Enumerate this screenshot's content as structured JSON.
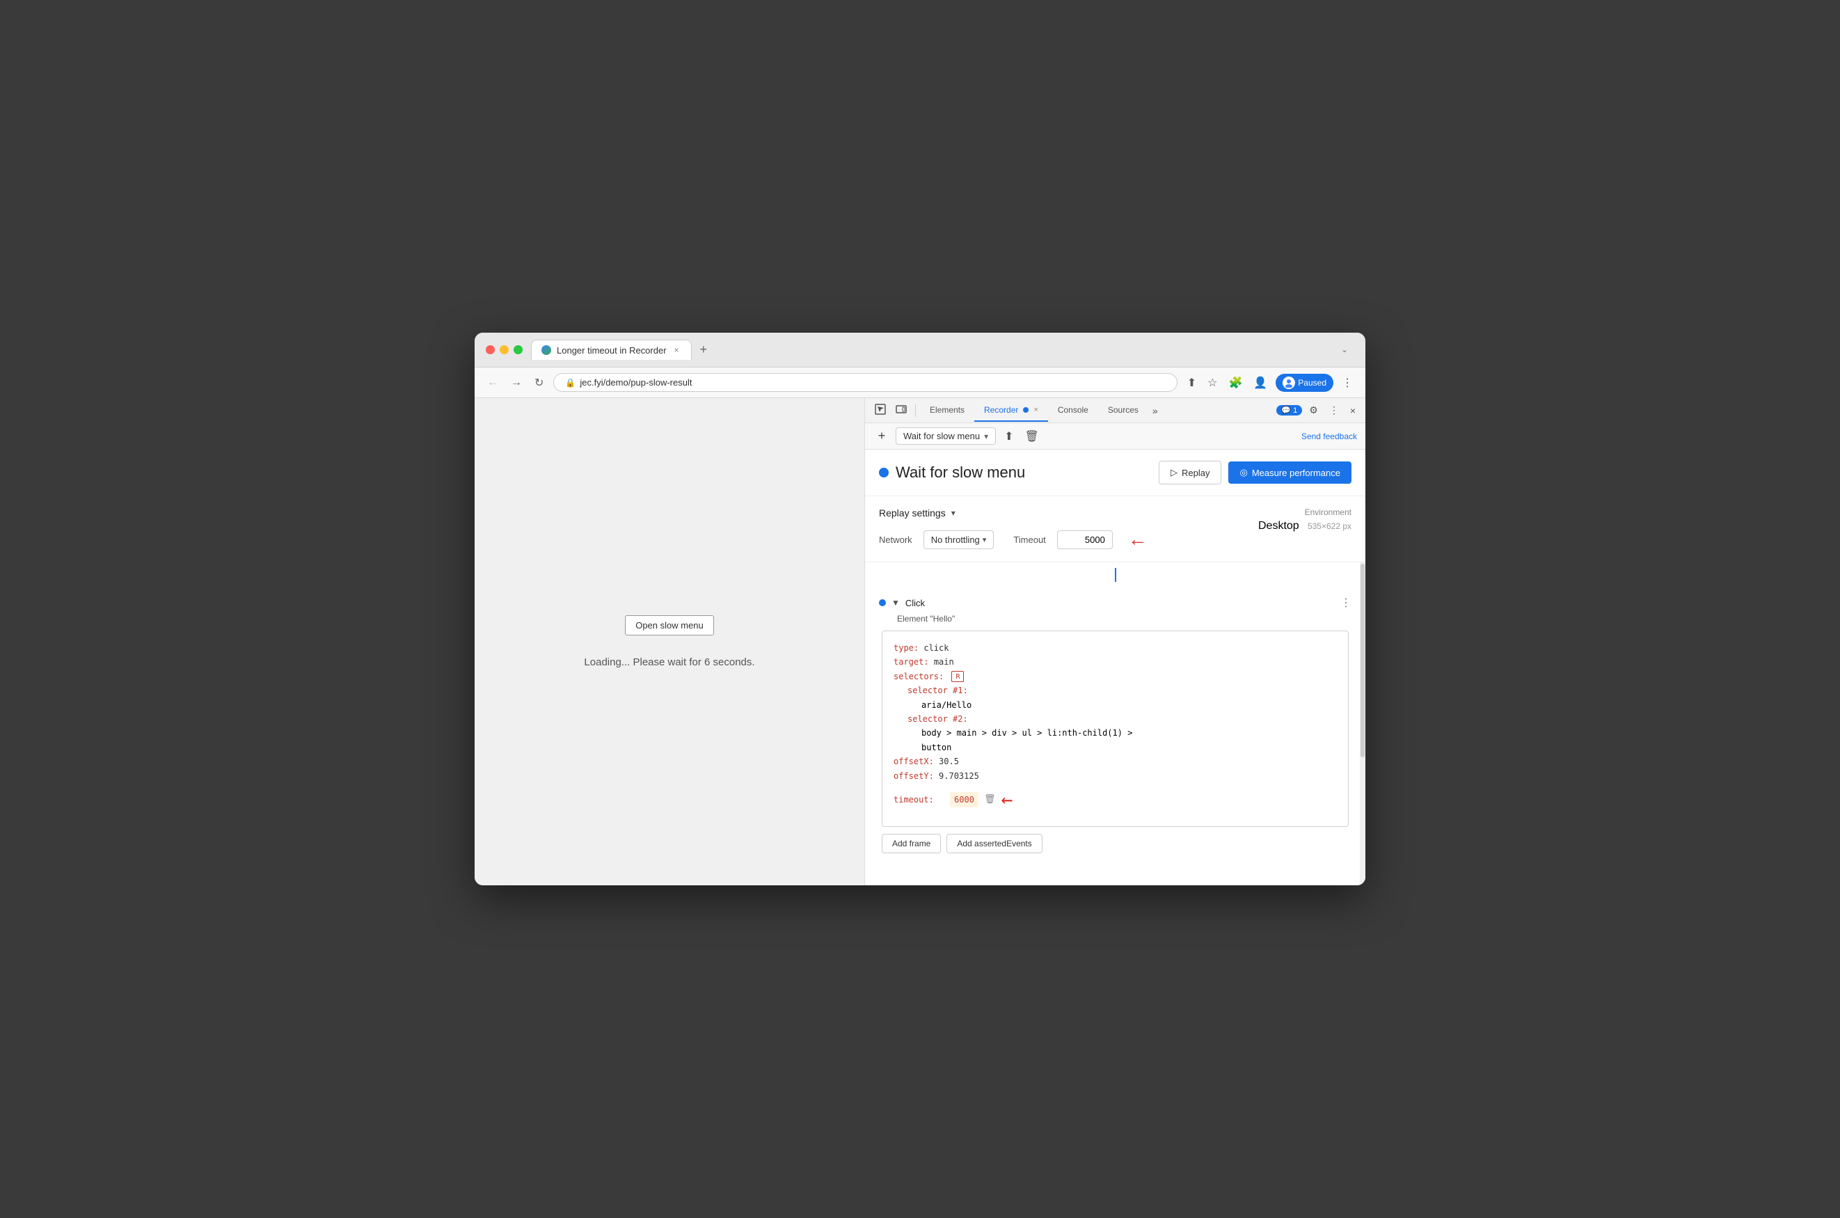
{
  "browser": {
    "tab_title": "Longer timeout in Recorder",
    "tab_close": "×",
    "tab_new": "+",
    "url": "jec.fyi/demo/pup-slow-result",
    "profile_label": "Paused",
    "window_collapse": "⌄"
  },
  "page": {
    "slow_menu_btn": "Open slow menu",
    "loading_text": "Loading... Please wait for 6 seconds."
  },
  "devtools": {
    "toolbar": {
      "inspect_icon": "⬚",
      "device_icon": "▭",
      "elements_tab": "Elements",
      "recorder_tab": "Recorder",
      "console_tab": "Console",
      "sources_tab": "Sources",
      "more_icon": "»",
      "tab_close": "×",
      "badge_label": "1",
      "settings_icon": "⚙",
      "more_dots": "⋮",
      "close_icon": "×"
    },
    "recorder_bar": {
      "add_icon": "+",
      "recording_name": "Wait for slow menu",
      "dropdown_arrow": "▾",
      "upload_icon": "⬆",
      "delete_icon": "🗑",
      "send_feedback": "Send feedback"
    },
    "header": {
      "title": "Wait for slow menu",
      "replay_btn": "Replay",
      "measure_btn": "Measure performance",
      "play_icon": "▷",
      "gauge_icon": "◎"
    },
    "replay_settings": {
      "title": "Replay settings",
      "arrow": "▾",
      "network_label": "Network",
      "network_value": "No throttling",
      "network_arrow": "▾",
      "timeout_label": "Timeout",
      "timeout_value": "5000"
    },
    "environment": {
      "label": "Environment",
      "device": "Desktop",
      "resolution": "535×622 px"
    },
    "click_step": {
      "name": "Click",
      "element": "Element \"Hello\"",
      "code": {
        "type_key": "type:",
        "type_val": " click",
        "target_key": "target:",
        "target_val": " main",
        "selectors_key": "selectors:",
        "selector1_key": "selector #1:",
        "selector1_val": "aria/Hello",
        "selector2_key": "selector #2:",
        "selector2_val": "body > main > div > ul > li:nth-child(1) >",
        "selector2_val2": "button",
        "offsetX_key": "offsetX:",
        "offsetX_val": " 30.5",
        "offsetY_key": "offsetY:",
        "offsetY_val": " 9.703125",
        "timeout_key": "timeout:",
        "timeout_val": "6000"
      },
      "add_frame_btn": "Add frame",
      "add_events_btn": "Add assertedEvents"
    }
  }
}
